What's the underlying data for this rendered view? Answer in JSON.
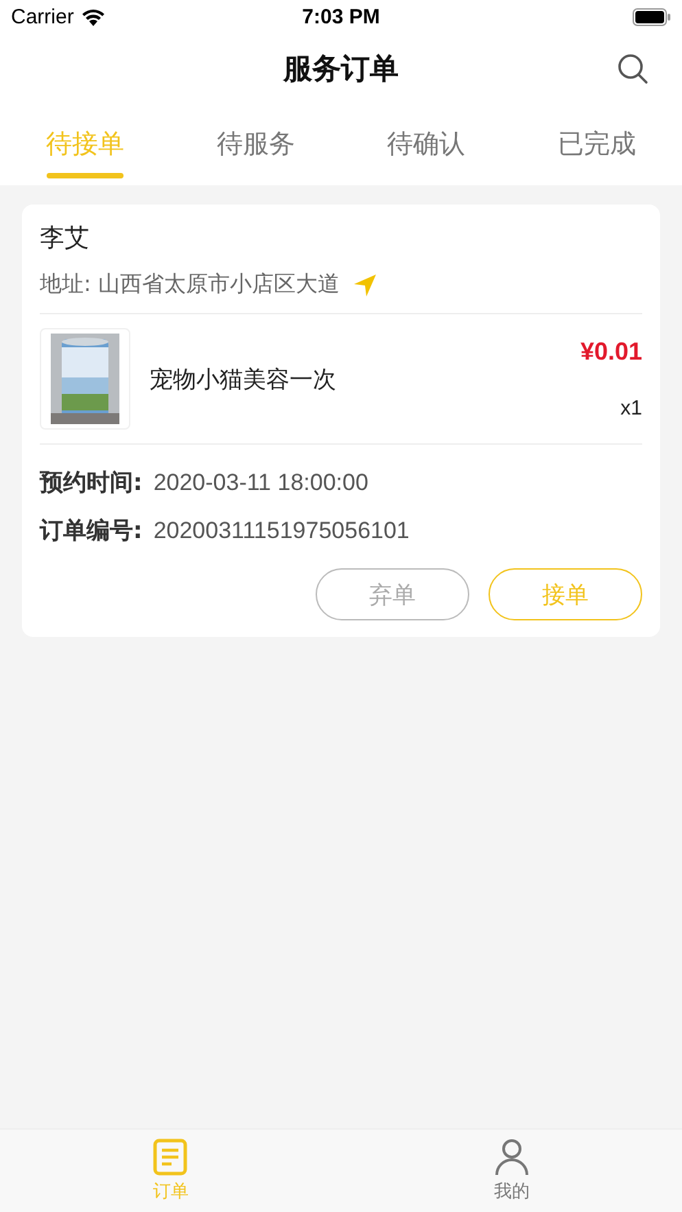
{
  "status_bar": {
    "carrier": "Carrier",
    "time": "7:03 PM"
  },
  "nav": {
    "title": "服务订单"
  },
  "tabs": [
    {
      "label": "待接单",
      "selected": true
    },
    {
      "label": "待服务",
      "selected": false
    },
    {
      "label": "待确认",
      "selected": false
    },
    {
      "label": "已完成",
      "selected": false
    }
  ],
  "orders": [
    {
      "customer": "李艾",
      "address": "地址: 山西省太原市小店区大道",
      "item": {
        "name": "宠物小猫美容一次",
        "price": "¥0.01",
        "quantity": "x1"
      },
      "fields": [
        {
          "label": "预约时间:",
          "value": "2020-03-11 18:00:00"
        },
        {
          "label": "订单编号:",
          "value": "20200311151975056101"
        }
      ],
      "buttons": [
        {
          "label": "弃单",
          "kind": "secondary"
        },
        {
          "label": "接单",
          "kind": "primary"
        }
      ]
    }
  ],
  "bottom_tabs": [
    {
      "label": "订单",
      "kind": "orders",
      "selected": true
    },
    {
      "label": "我的",
      "kind": "profile",
      "selected": false
    }
  ]
}
